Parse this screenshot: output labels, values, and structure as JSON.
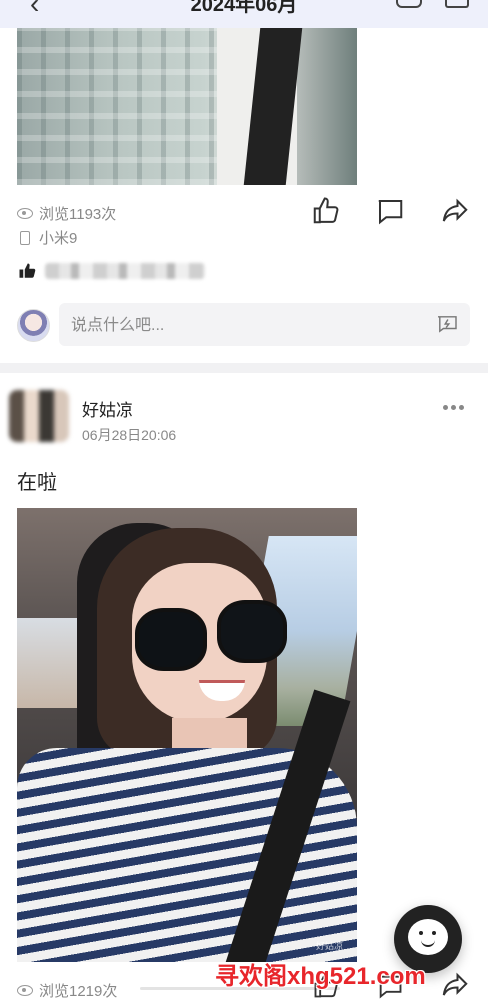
{
  "header": {
    "title": "2024年06月"
  },
  "post1": {
    "views": "浏览1193次",
    "device": "小米9",
    "liked_prefix": "💗"
  },
  "comment": {
    "placeholder": "说点什么吧..."
  },
  "post2": {
    "username": "好姑凉",
    "time": "06月28日20:06",
    "text": "在啦",
    "image_watermark": "好姑凉",
    "views": "浏览1219次"
  },
  "watermark": {
    "text": "寻欢阁xhg521.com"
  },
  "colors": {
    "watermark": "#e8262b",
    "divider": "#f1f1f3",
    "input_bg": "#f3f3f5"
  }
}
